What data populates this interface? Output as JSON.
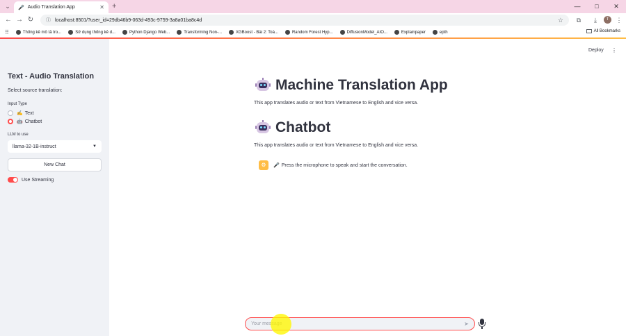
{
  "browser": {
    "tab_title": "Audio Translation App",
    "tab_icon": "microphone-icon",
    "url": "localhost:8501/?user_id=29db46b9-063d-493c-9759-3a8a01ba8c4d",
    "profile_initial": "T"
  },
  "bookmarks": {
    "items": [
      "Thống kê mô tả tro...",
      "Sử dụng thống kê d...",
      "Python Django Web...",
      "Transforming Non-...",
      "XGBoost - Bài 2: Toà...",
      "Random Forest Hyp...",
      "DiffusionModel_AIO...",
      "Explainpaper",
      "epth"
    ],
    "all_label": "All Bookmarks"
  },
  "sidebar": {
    "title": "Text - Audio Translation",
    "subtitle": "Select source translation:",
    "input_type_label": "Input Type",
    "options": [
      {
        "emoji": "✍",
        "label": "Text",
        "selected": false
      },
      {
        "emoji": "🤖",
        "label": "Chatbot",
        "selected": true
      }
    ],
    "llm_label": "LLM to use",
    "llm_value": "llama-32-1B-instruct",
    "new_chat_label": "New Chat",
    "streaming_label": "Use Streaming",
    "streaming_on": true
  },
  "header": {
    "deploy_label": "Deploy",
    "menu_icon": "kebab-menu-icon"
  },
  "main": {
    "title1": "Machine Translation App",
    "desc1": "This app translates audio or text from Vietnamese to English and vice versa.",
    "title2": "Chatbot",
    "desc2": "This app translates audio or text from Vietnamese to English and vice versa.",
    "assistant_message": "Press the microphone to speak and start the conversation.",
    "assistant_message_emoji": "🎤",
    "chat_placeholder": "Your message"
  },
  "colors": {
    "accent": "#ff4b4b",
    "sidebar_bg": "#f0f2f6",
    "tabbar_bg": "#f6d6e6",
    "assistant_avatar": "#ffbd45"
  }
}
